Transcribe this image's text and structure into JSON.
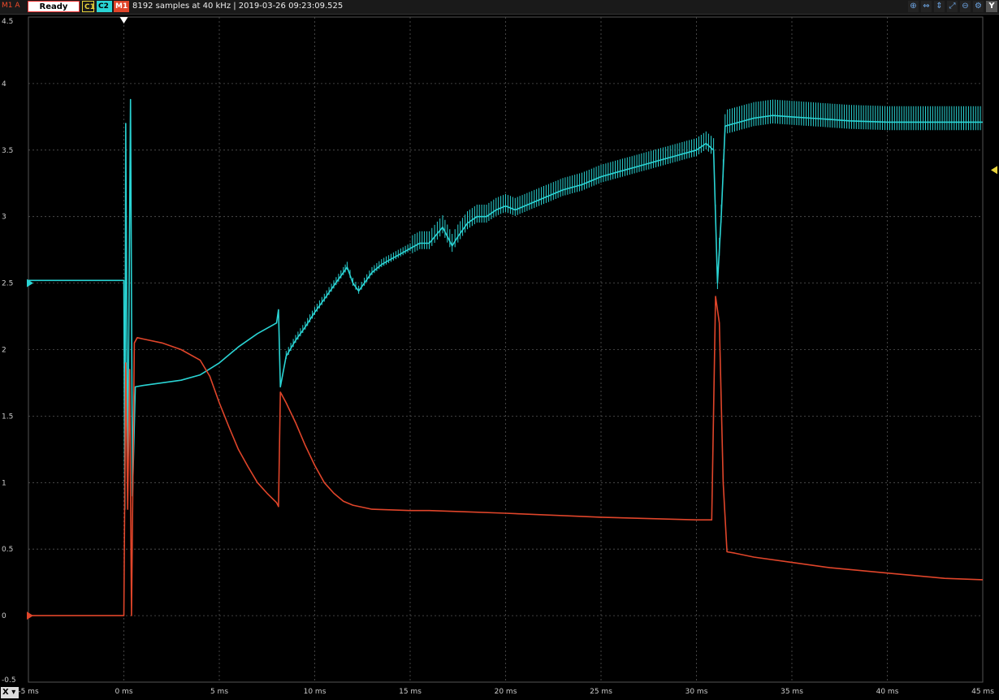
{
  "toolbar": {
    "unit_label": "M1 A",
    "status": "Ready",
    "channels": [
      {
        "label": "C1",
        "color": "#e6d23a"
      },
      {
        "label": "C2",
        "color": "#2ad4d4"
      },
      {
        "label": "M1",
        "color": "#e0452a"
      }
    ],
    "acquisition_info": "8192 samples at 40 kHz | 2019-03-26 09:23:09.525",
    "icons": [
      "zoom-in-icon",
      "zoom-x-icon",
      "zoom-y-icon",
      "zoom-xy-icon",
      "zoom-out-icon",
      "settings-icon"
    ],
    "y_button": "Y"
  },
  "x_button": "X",
  "chart_data": {
    "type": "line",
    "xlabel": "",
    "ylabel": "",
    "x_unit": "ms",
    "xlim": [
      -5,
      45
    ],
    "ylim": [
      -0.5,
      4.5
    ],
    "x_ticks": [
      "-5 ms",
      "0 ms",
      "5 ms",
      "10 ms",
      "15 ms",
      "20 ms",
      "25 ms",
      "30 ms",
      "35 ms",
      "40 ms",
      "45 ms"
    ],
    "y_ticks": [
      "4.5",
      "4",
      "3.5",
      "3",
      "2.5",
      "2",
      "1.5",
      "1",
      "0.5",
      "0",
      "-0.5"
    ],
    "grid": true,
    "background": "#000000",
    "series": [
      {
        "name": "C2",
        "color": "#2ad4d4",
        "marker_level": 2.5,
        "points": [
          [
            -5,
            2.52
          ],
          [
            0,
            2.52
          ],
          [
            0.05,
            0.8
          ],
          [
            0.1,
            3.7
          ],
          [
            0.2,
            1.0
          ],
          [
            0.35,
            3.88
          ],
          [
            0.45,
            0.9
          ],
          [
            0.6,
            1.72
          ],
          [
            1,
            1.73
          ],
          [
            2,
            1.75
          ],
          [
            3,
            1.77
          ],
          [
            4,
            1.81
          ],
          [
            5,
            1.9
          ],
          [
            6,
            2.02
          ],
          [
            7,
            2.12
          ],
          [
            8,
            2.2
          ],
          [
            8.1,
            2.3
          ],
          [
            8.2,
            1.72
          ],
          [
            8.5,
            1.95
          ],
          [
            9,
            2.07
          ],
          [
            9.5,
            2.17
          ],
          [
            10,
            2.28
          ],
          [
            10.5,
            2.38
          ],
          [
            11,
            2.48
          ],
          [
            11.5,
            2.58
          ],
          [
            11.7,
            2.62
          ],
          [
            12,
            2.5
          ],
          [
            12.3,
            2.44
          ],
          [
            12.6,
            2.5
          ],
          [
            13,
            2.58
          ],
          [
            13.5,
            2.64
          ],
          [
            14,
            2.68
          ],
          [
            14.5,
            2.72
          ],
          [
            15,
            2.76
          ],
          [
            15.5,
            2.8
          ],
          [
            16,
            2.8
          ],
          [
            16.7,
            2.92
          ],
          [
            17.2,
            2.78
          ],
          [
            17.5,
            2.85
          ],
          [
            18,
            2.95
          ],
          [
            18.5,
            3.0
          ],
          [
            19,
            3.0
          ],
          [
            19.5,
            3.05
          ],
          [
            20,
            3.08
          ],
          [
            20.5,
            3.05
          ],
          [
            21,
            3.08
          ],
          [
            22,
            3.14
          ],
          [
            23,
            3.2
          ],
          [
            24,
            3.24
          ],
          [
            25,
            3.3
          ],
          [
            26,
            3.34
          ],
          [
            27,
            3.38
          ],
          [
            28,
            3.42
          ],
          [
            29,
            3.46
          ],
          [
            30,
            3.5
          ],
          [
            30.5,
            3.55
          ],
          [
            30.9,
            3.5
          ],
          [
            31.1,
            2.5
          ],
          [
            31.3,
            3.0
          ],
          [
            31.5,
            3.68
          ],
          [
            32,
            3.7
          ],
          [
            33,
            3.74
          ],
          [
            34,
            3.76
          ],
          [
            35,
            3.75
          ],
          [
            36,
            3.74
          ],
          [
            37,
            3.73
          ],
          [
            38,
            3.72
          ],
          [
            40,
            3.71
          ],
          [
            42,
            3.71
          ],
          [
            45,
            3.71
          ]
        ]
      },
      {
        "name": "M1",
        "color": "#e0452a",
        "marker_level": 0,
        "points": [
          [
            -5,
            0
          ],
          [
            0,
            0
          ],
          [
            0.1,
            1.9
          ],
          [
            0.2,
            0.8
          ],
          [
            0.3,
            1.85
          ],
          [
            0.4,
            0.0
          ],
          [
            0.55,
            2.05
          ],
          [
            0.7,
            2.09
          ],
          [
            1,
            2.08
          ],
          [
            2,
            2.05
          ],
          [
            3,
            2.0
          ],
          [
            4,
            1.92
          ],
          [
            4.5,
            1.8
          ],
          [
            5,
            1.6
          ],
          [
            5.5,
            1.42
          ],
          [
            6,
            1.25
          ],
          [
            6.5,
            1.12
          ],
          [
            7,
            1.0
          ],
          [
            7.5,
            0.92
          ],
          [
            8,
            0.85
          ],
          [
            8.1,
            0.82
          ],
          [
            8.2,
            1.68
          ],
          [
            8.5,
            1.6
          ],
          [
            9,
            1.45
          ],
          [
            9.5,
            1.28
          ],
          [
            10,
            1.13
          ],
          [
            10.5,
            1.0
          ],
          [
            11,
            0.92
          ],
          [
            11.5,
            0.86
          ],
          [
            12,
            0.83
          ],
          [
            13,
            0.8
          ],
          [
            15,
            0.79
          ],
          [
            16,
            0.79
          ],
          [
            18,
            0.78
          ],
          [
            20,
            0.77
          ],
          [
            25,
            0.74
          ],
          [
            30,
            0.72
          ],
          [
            30.8,
            0.72
          ],
          [
            31,
            2.4
          ],
          [
            31.2,
            2.2
          ],
          [
            31.4,
            1.0
          ],
          [
            31.6,
            0.48
          ],
          [
            32,
            0.47
          ],
          [
            33,
            0.44
          ],
          [
            35,
            0.4
          ],
          [
            37,
            0.36
          ],
          [
            40,
            0.32
          ],
          [
            43,
            0.28
          ],
          [
            45,
            0.27
          ]
        ]
      }
    ]
  }
}
